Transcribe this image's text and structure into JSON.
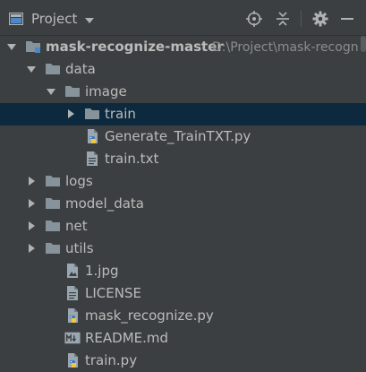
{
  "toolbar": {
    "view_label": "Project",
    "view_icon": "project-window-icon",
    "buttons": [
      {
        "name": "locate-icon"
      },
      {
        "name": "collapse-all-icon"
      },
      {
        "name": "gear-icon"
      },
      {
        "name": "minimize-icon"
      }
    ]
  },
  "tree": {
    "selected_index": 3,
    "rows": [
      {
        "label": "mask-recognize-master",
        "path": "D:\\Project\\mask-recogn",
        "type": "module-folder",
        "expanded": true,
        "depth": 0,
        "bold": true
      },
      {
        "label": "data",
        "type": "folder",
        "expanded": true,
        "depth": 1
      },
      {
        "label": "image",
        "type": "folder",
        "expanded": true,
        "depth": 2
      },
      {
        "label": "train",
        "type": "folder",
        "expanded": false,
        "depth": 3
      },
      {
        "label": "Generate_TrainTXT.py",
        "type": "python",
        "depth": 3
      },
      {
        "label": "train.txt",
        "type": "text",
        "depth": 3
      },
      {
        "label": "logs",
        "type": "folder",
        "expanded": false,
        "depth": 1
      },
      {
        "label": "model_data",
        "type": "folder",
        "expanded": false,
        "depth": 1
      },
      {
        "label": "net",
        "type": "folder",
        "expanded": false,
        "depth": 1
      },
      {
        "label": "utils",
        "type": "folder",
        "expanded": false,
        "depth": 1
      },
      {
        "label": "1.jpg",
        "type": "image-file",
        "depth": 2
      },
      {
        "label": "LICENSE",
        "type": "text",
        "depth": 2
      },
      {
        "label": "mask_recognize.py",
        "type": "python",
        "depth": 2
      },
      {
        "label": "README.md",
        "type": "markdown",
        "depth": 2
      },
      {
        "label": "train.py",
        "type": "python",
        "depth": 2
      }
    ]
  }
}
